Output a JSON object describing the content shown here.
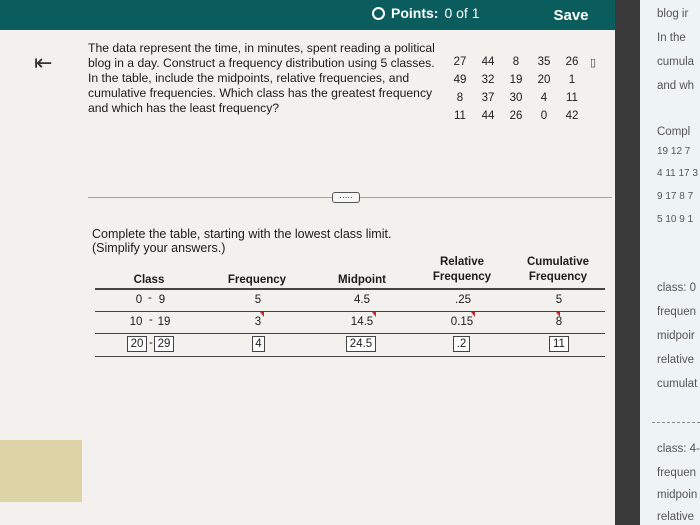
{
  "header": {
    "points_label": "Points:",
    "points_value": "0 of 1",
    "save_label": "Save"
  },
  "question": {
    "text": "The data represent the time, in minutes, spent reading a political blog in a day. Construct a frequency distribution using 5 classes. In the table, include the midpoints, relative frequencies, and cumulative frequencies. Which class has the greatest frequency and which has the least frequency?",
    "data_rows": [
      [
        "27",
        "44",
        "8",
        "35",
        "26"
      ],
      [
        "49",
        "32",
        "19",
        "20",
        "1"
      ],
      [
        "8",
        "37",
        "30",
        "4",
        "11"
      ],
      [
        "11",
        "44",
        "26",
        "0",
        "42"
      ]
    ]
  },
  "more_button": "·····",
  "instruction": {
    "line1": "Complete the table, starting with the lowest class limit.",
    "line2": "(Simplify your answers.)"
  },
  "table": {
    "headers": {
      "class": "Class",
      "frequency": "Frequency",
      "midpoint": "Midpoint",
      "relative_1": "Relative",
      "relative_2": "Frequency",
      "cumulative_1": "Cumulative",
      "cumulative_2": "Frequency"
    },
    "rows": [
      {
        "class_low": "0",
        "class_high": "9",
        "frequency": "5",
        "midpoint": "4.5",
        "relative": ".25",
        "cumulative": "5"
      },
      {
        "class_low": "10",
        "class_high": "19",
        "frequency": "3",
        "midpoint": "14.5",
        "relative": "0.15",
        "cumulative": "8"
      },
      {
        "class_low": "20",
        "class_high": "29",
        "frequency": "4",
        "midpoint": "24.5",
        "relative": ".2",
        "cumulative": "11"
      }
    ],
    "dash": "-"
  },
  "right_panel": {
    "lines": [
      "blog ir",
      "In the",
      "cumula",
      "and wh",
      "Compl",
      "19 12 7",
      "4 11 17 3",
      "9 17 8 7",
      "5 10 9 1",
      "class: 0",
      "frequen",
      "midpoir",
      "relative",
      "cumulat",
      "class: 4-",
      "frequen",
      "midpoin",
      "relative"
    ]
  },
  "colors": {
    "header_bg": "#0b5d5d",
    "incorrect_mark": "#c62828"
  }
}
